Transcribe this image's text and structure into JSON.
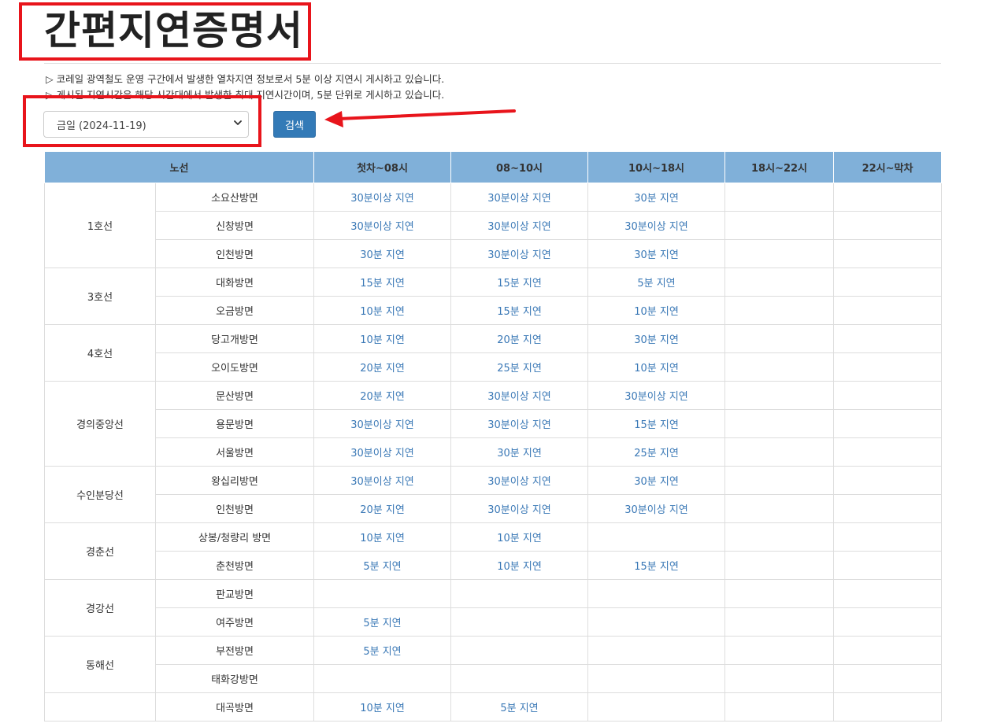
{
  "page": {
    "title": "간편지연증명서",
    "notices": [
      "▷ 코레일 광역철도 운영 구간에서 발생한 열차지연 정보로서 5분 이상 지연시 게시하고 있습니다.",
      "▷ 게시된 지연시간은 해당 시간대에서 발생한 최대 지연시간이며, 5분 단위로 게시하고 있습니다."
    ]
  },
  "search": {
    "selected_date": "금일 (2024-11-19)",
    "button_label": "검색"
  },
  "annotations": {
    "highlight_color": "#e8141b"
  },
  "table": {
    "headers": [
      "노선",
      "첫차~08시",
      "08~10시",
      "10시~18시",
      "18시~22시",
      "22시~막차"
    ],
    "groups": [
      {
        "line": "1호선",
        "rows": [
          {
            "dir": "소요산방면",
            "vals": [
              "30분이상 지연",
              "30분이상 지연",
              "30분 지연",
              "",
              ""
            ]
          },
          {
            "dir": "신창방면",
            "vals": [
              "30분이상 지연",
              "30분이상 지연",
              "30분이상 지연",
              "",
              ""
            ]
          },
          {
            "dir": "인천방면",
            "vals": [
              "30분 지연",
              "30분이상 지연",
              "30분 지연",
              "",
              ""
            ]
          }
        ]
      },
      {
        "line": "3호선",
        "rows": [
          {
            "dir": "대화방면",
            "vals": [
              "15분 지연",
              "15분 지연",
              "5분 지연",
              "",
              ""
            ]
          },
          {
            "dir": "오금방면",
            "vals": [
              "10분 지연",
              "15분 지연",
              "10분 지연",
              "",
              ""
            ]
          }
        ]
      },
      {
        "line": "4호선",
        "rows": [
          {
            "dir": "당고개방면",
            "vals": [
              "10분 지연",
              "20분 지연",
              "30분 지연",
              "",
              ""
            ]
          },
          {
            "dir": "오이도방면",
            "vals": [
              "20분 지연",
              "25분 지연",
              "10분 지연",
              "",
              ""
            ]
          }
        ]
      },
      {
        "line": "경의중앙선",
        "rows": [
          {
            "dir": "문산방면",
            "vals": [
              "20분 지연",
              "30분이상 지연",
              "30분이상 지연",
              "",
              ""
            ]
          },
          {
            "dir": "용문방면",
            "vals": [
              "30분이상 지연",
              "30분이상 지연",
              "15분 지연",
              "",
              ""
            ]
          },
          {
            "dir": "서울방면",
            "vals": [
              "30분이상 지연",
              "30분 지연",
              "25분 지연",
              "",
              ""
            ]
          }
        ]
      },
      {
        "line": "수인분당선",
        "rows": [
          {
            "dir": "왕십리방면",
            "vals": [
              "30분이상 지연",
              "30분이상 지연",
              "30분 지연",
              "",
              ""
            ]
          },
          {
            "dir": "인천방면",
            "vals": [
              "20분 지연",
              "30분이상 지연",
              "30분이상 지연",
              "",
              ""
            ]
          }
        ]
      },
      {
        "line": "경춘선",
        "rows": [
          {
            "dir": "상봉/청량리 방면",
            "vals": [
              "10분 지연",
              "10분 지연",
              "",
              "",
              ""
            ]
          },
          {
            "dir": "춘천방면",
            "vals": [
              "5분 지연",
              "10분 지연",
              "15분 지연",
              "",
              ""
            ]
          }
        ]
      },
      {
        "line": "경강선",
        "rows": [
          {
            "dir": "판교방면",
            "vals": [
              "",
              "",
              "",
              "",
              ""
            ]
          },
          {
            "dir": "여주방면",
            "vals": [
              "5분 지연",
              "",
              "",
              "",
              ""
            ]
          }
        ]
      },
      {
        "line": "동해선",
        "rows": [
          {
            "dir": "부전방면",
            "vals": [
              "5분 지연",
              "",
              "",
              "",
              ""
            ]
          },
          {
            "dir": "태화강방면",
            "vals": [
              "",
              "",
              "",
              "",
              ""
            ]
          }
        ]
      },
      {
        "line": "",
        "rows": [
          {
            "dir": "대곡방면",
            "vals": [
              "10분 지연",
              "5분 지연",
              "",
              "",
              ""
            ]
          }
        ]
      }
    ]
  }
}
